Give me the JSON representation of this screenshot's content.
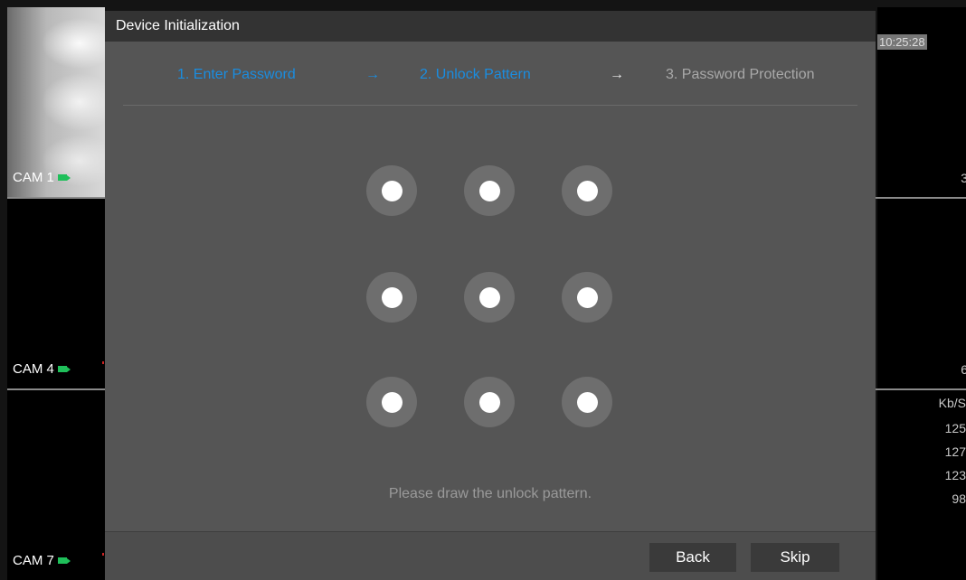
{
  "dialog": {
    "title": "Device Initialization",
    "steps": [
      {
        "label": "1.  Enter Password",
        "state": "done"
      },
      {
        "label": "2.  Unlock Pattern",
        "state": "current"
      },
      {
        "label": "3.  Password Protection",
        "state": "pending"
      }
    ],
    "arrows": [
      "→",
      "→"
    ],
    "hint": "Please draw the unlock pattern.",
    "buttons": {
      "back": "Back",
      "skip": "Skip"
    },
    "pattern_dots": 9
  },
  "cameras": [
    {
      "label": "CAM 1"
    },
    {
      "label": "CAM 4"
    },
    {
      "label": "CAM 7"
    }
  ],
  "status": {
    "time": "10:25:28",
    "right_edge_values": [
      "3",
      "6"
    ],
    "bitrate_header": "Kb/S",
    "bitrates": [
      "125",
      "127",
      "123",
      "98"
    ]
  },
  "colors": {
    "accent": "#1a8de0",
    "dialog_bg": "#555555",
    "title_bar": "#333333",
    "record_icon": "#1fbf5a"
  }
}
